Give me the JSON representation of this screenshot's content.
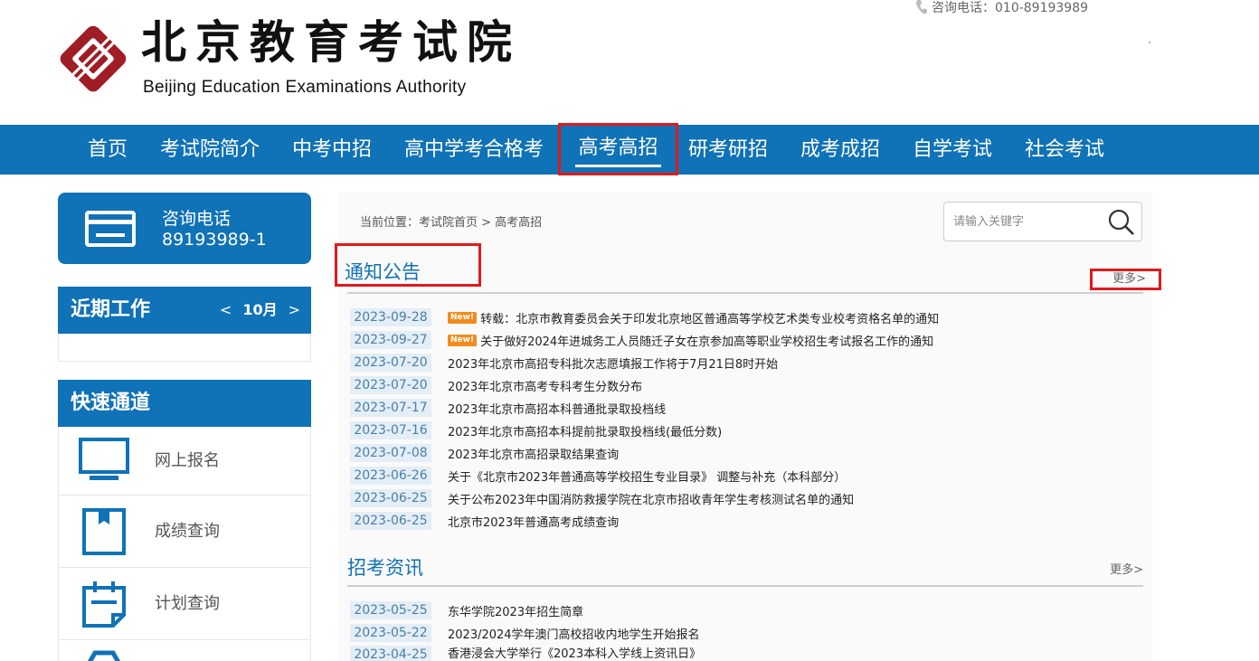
{
  "header": {
    "logo_cn": "北京教育考试院",
    "logo_en": "Beijing Education Examinations Authority",
    "hotline": "咨询电话：010-89193989",
    "colors": {
      "brand_red": "#a01d26",
      "nav_blue": "#1072b7",
      "highlight_red": "#e2191c"
    }
  },
  "nav": {
    "items": [
      {
        "label": "首页"
      },
      {
        "label": "考试院简介"
      },
      {
        "label": "中考中招"
      },
      {
        "label": "高中学考合格考"
      },
      {
        "label": "高考高招"
      },
      {
        "label": "研考研招"
      },
      {
        "label": "成考成招"
      },
      {
        "label": "自学考试"
      },
      {
        "label": "社会考试"
      }
    ],
    "active": "高考高招"
  },
  "sidebar": {
    "hotline_title": "咨询电话",
    "hotline_number": "89193989-1",
    "recent_work": {
      "title": "近期工作",
      "prev": "<",
      "month": "10月",
      "next": ">"
    },
    "quick": {
      "title": "快速通道",
      "items": [
        {
          "label": "网上报名",
          "icon": "monitor-icon"
        },
        {
          "label": "成绩查询",
          "icon": "bookmark-icon"
        },
        {
          "label": "计划查询",
          "icon": "calendar-icon"
        }
      ]
    }
  },
  "main": {
    "breadcrumb": "当前位置：考试院首页 > 高考高招",
    "search": {
      "placeholder": "请输入关键字",
      "value": ""
    },
    "notices": {
      "title": "通知公告",
      "more": "更多>",
      "items": [
        {
          "date": "2023-09-28",
          "new": "New!",
          "title": "转载：北京市教育委员会关于印发北京地区普通高等学校艺术类专业校考资格名单的通知"
        },
        {
          "date": "2023-09-27",
          "new": "New!",
          "title": "关于做好2024年进城务工人员随迁子女在京参加高等职业学校招生考试报名工作的通知"
        },
        {
          "date": "2023-07-20",
          "title": "2023年北京市高招专科批次志愿填报工作将于7月21日8时开始"
        },
        {
          "date": "2023-07-20",
          "title": "2023年北京市高考专科考生分数分布"
        },
        {
          "date": "2023-07-17",
          "title": "2023年北京市高招本科普通批录取投档线"
        },
        {
          "date": "2023-07-16",
          "title": "2023年北京市高招本科提前批录取投档线(最低分数)"
        },
        {
          "date": "2023-07-08",
          "title": "2023年北京市高招录取结果查询"
        },
        {
          "date": "2023-06-26",
          "title": "关于《北京市2023年普通高等学校招生专业目录》 调整与补充（本科部分）"
        },
        {
          "date": "2023-06-25",
          "title": "关于公布2023年中国消防救援学院在北京市招收青年学生考核测试名单的通知"
        },
        {
          "date": "2023-06-25",
          "title": "北京市2023年普通高考成绩查询"
        }
      ]
    },
    "info": {
      "title": "招考资讯",
      "more": "更多>",
      "items": [
        {
          "date": "2023-05-25",
          "title": "东华学院2023年招生简章"
        },
        {
          "date": "2023-05-22",
          "title": "2023/2024学年澳门高校招收内地学生开始报名"
        },
        {
          "date": "2023-04-25",
          "title": "香港浸会大学举行《2023本科入学线上资讯日》"
        }
      ]
    }
  }
}
